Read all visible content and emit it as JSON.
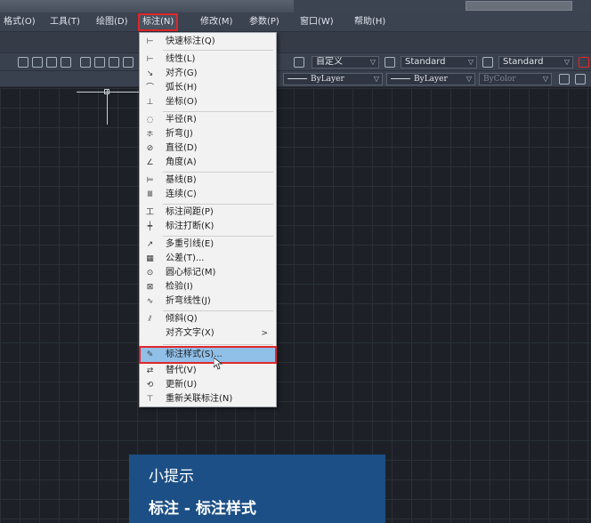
{
  "menubar": {
    "items": [
      "格式(O)",
      "工具(T)",
      "绘图(D)",
      "标注(N)",
      "修改(M)",
      "参数(P)",
      "窗口(W)",
      "帮助(H)"
    ]
  },
  "toolbar": {
    "text_style": "自定义",
    "dim_style": "Standard",
    "table_style": "Standard",
    "linetype": "ByLayer",
    "lineweight": "ByLayer",
    "plotstyle": "ByColor"
  },
  "dimension_menu": {
    "items": [
      {
        "icon": "quick-dimension-icon",
        "label": "快速标注(Q)"
      },
      {
        "icon": "linear-icon",
        "label": "线性(L)"
      },
      {
        "icon": "aligned-icon",
        "label": "对齐(G)"
      },
      {
        "icon": "arc-length-icon",
        "label": "弧长(H)"
      },
      {
        "icon": "ordinate-icon",
        "label": "坐标(O)"
      },
      {
        "icon": "radius-icon",
        "label": "半径(R)"
      },
      {
        "icon": "jogged-icon",
        "label": "折弯(J)"
      },
      {
        "icon": "diameter-icon",
        "label": "直径(D)"
      },
      {
        "icon": "angular-icon",
        "label": "角度(A)"
      },
      {
        "icon": "baseline-icon",
        "label": "基线(B)"
      },
      {
        "icon": "continue-icon",
        "label": "连续(C)"
      },
      {
        "icon": "dim-space-icon",
        "label": "标注间距(P)"
      },
      {
        "icon": "dim-break-icon",
        "label": "标注打断(K)"
      },
      {
        "icon": "multileader-icon",
        "label": "多重引线(E)"
      },
      {
        "icon": "tolerance-icon",
        "label": "公差(T)..."
      },
      {
        "icon": "center-mark-icon",
        "label": "圆心标记(M)"
      },
      {
        "icon": "inspection-icon",
        "label": "检验(I)"
      },
      {
        "icon": "jogged-linear-icon",
        "label": "折弯线性(J)"
      },
      {
        "icon": "oblique-icon",
        "label": "倾斜(Q)"
      },
      {
        "icon": "",
        "label": "对齐文字(X)",
        "submenu": ">"
      },
      {
        "icon": "dim-style-icon",
        "label": "标注样式(S)..."
      },
      {
        "icon": "override-icon",
        "label": "替代(V)"
      },
      {
        "icon": "update-icon",
        "label": "更新(U)"
      },
      {
        "icon": "reassociate-icon",
        "label": "重新关联标注(N)"
      }
    ]
  },
  "tip": {
    "title": "小提示",
    "body": "标注 - 标注样式"
  },
  "colors": {
    "highlight": "#90bfe8",
    "callout": "#e0262b",
    "tip_background": "#1c4f85"
  }
}
